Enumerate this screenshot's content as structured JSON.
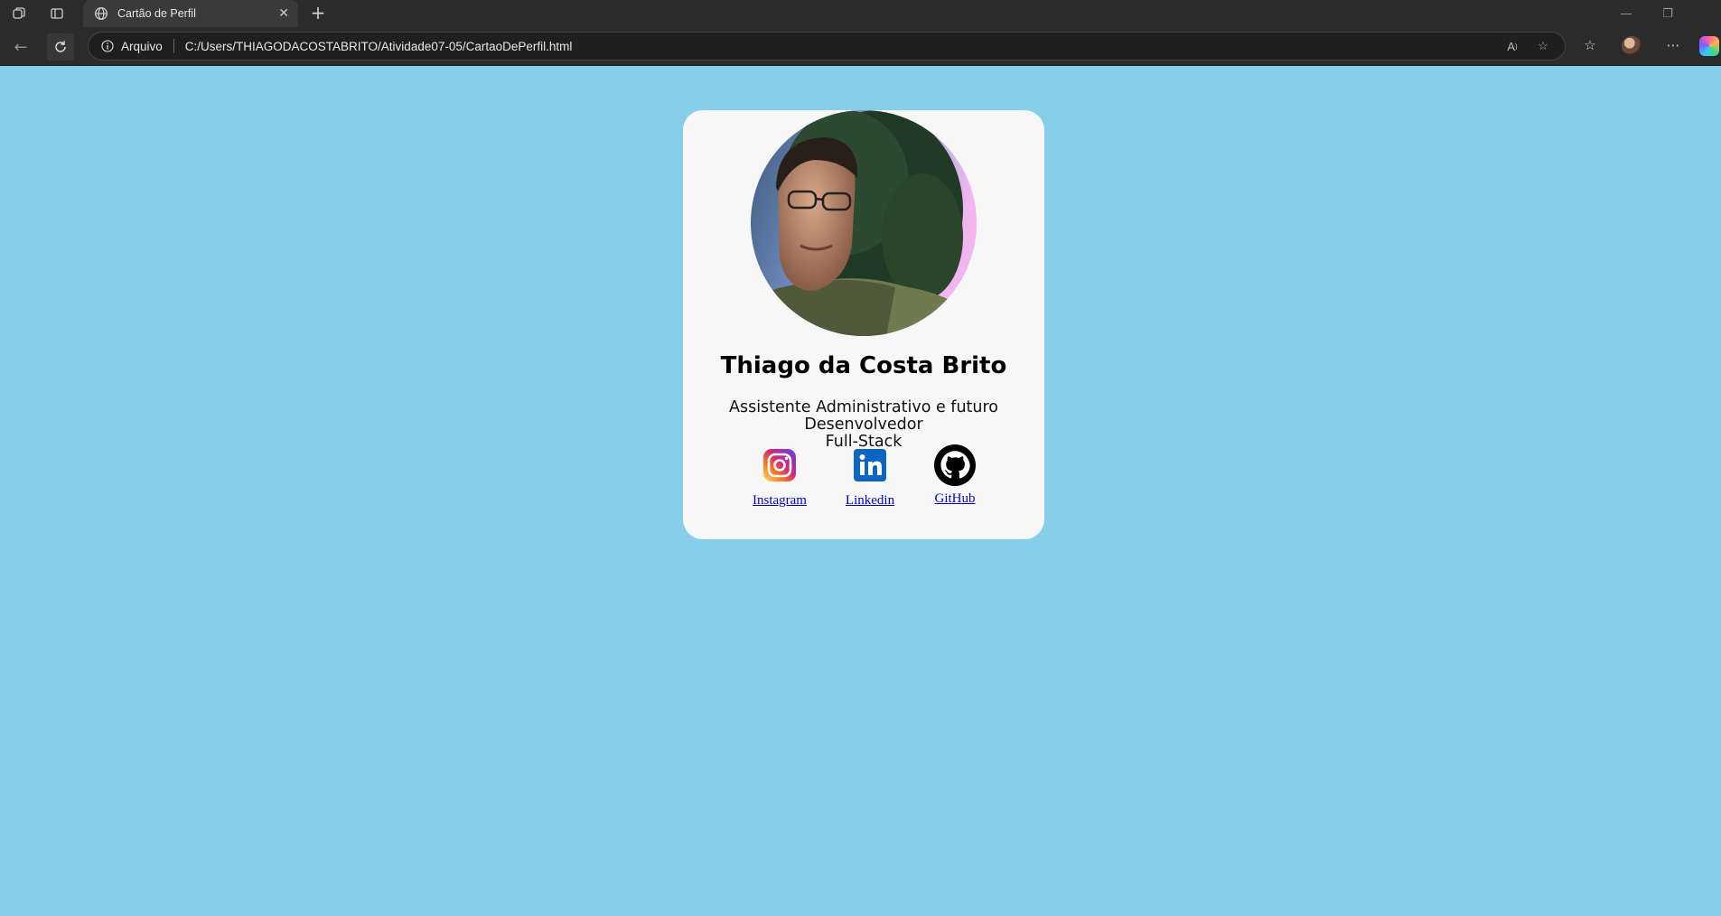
{
  "browser": {
    "tab_title": "Cartão de Perfil",
    "address_scheme": "Arquivo",
    "address_url": "C:/Users/THIAGODACOSTABRITO/Atividade07-05/CartaoDePerfil.html"
  },
  "profile": {
    "name": "Thiago da Costa Brito",
    "role_line1": "Assistente Administrativo e futuro Desenvolvedor",
    "role_line2": "Full-Stack",
    "links": [
      {
        "label": "Instagram",
        "icon": "instagram-icon"
      },
      {
        "label": "Linkedin",
        "icon": "linkedin-icon"
      },
      {
        "label": "GitHub",
        "icon": "github-icon"
      }
    ]
  },
  "colors": {
    "page_background": "#87ceea",
    "card_background": "#f7f7f7",
    "link": "#0000cc",
    "chrome": "#2b2b2b"
  }
}
